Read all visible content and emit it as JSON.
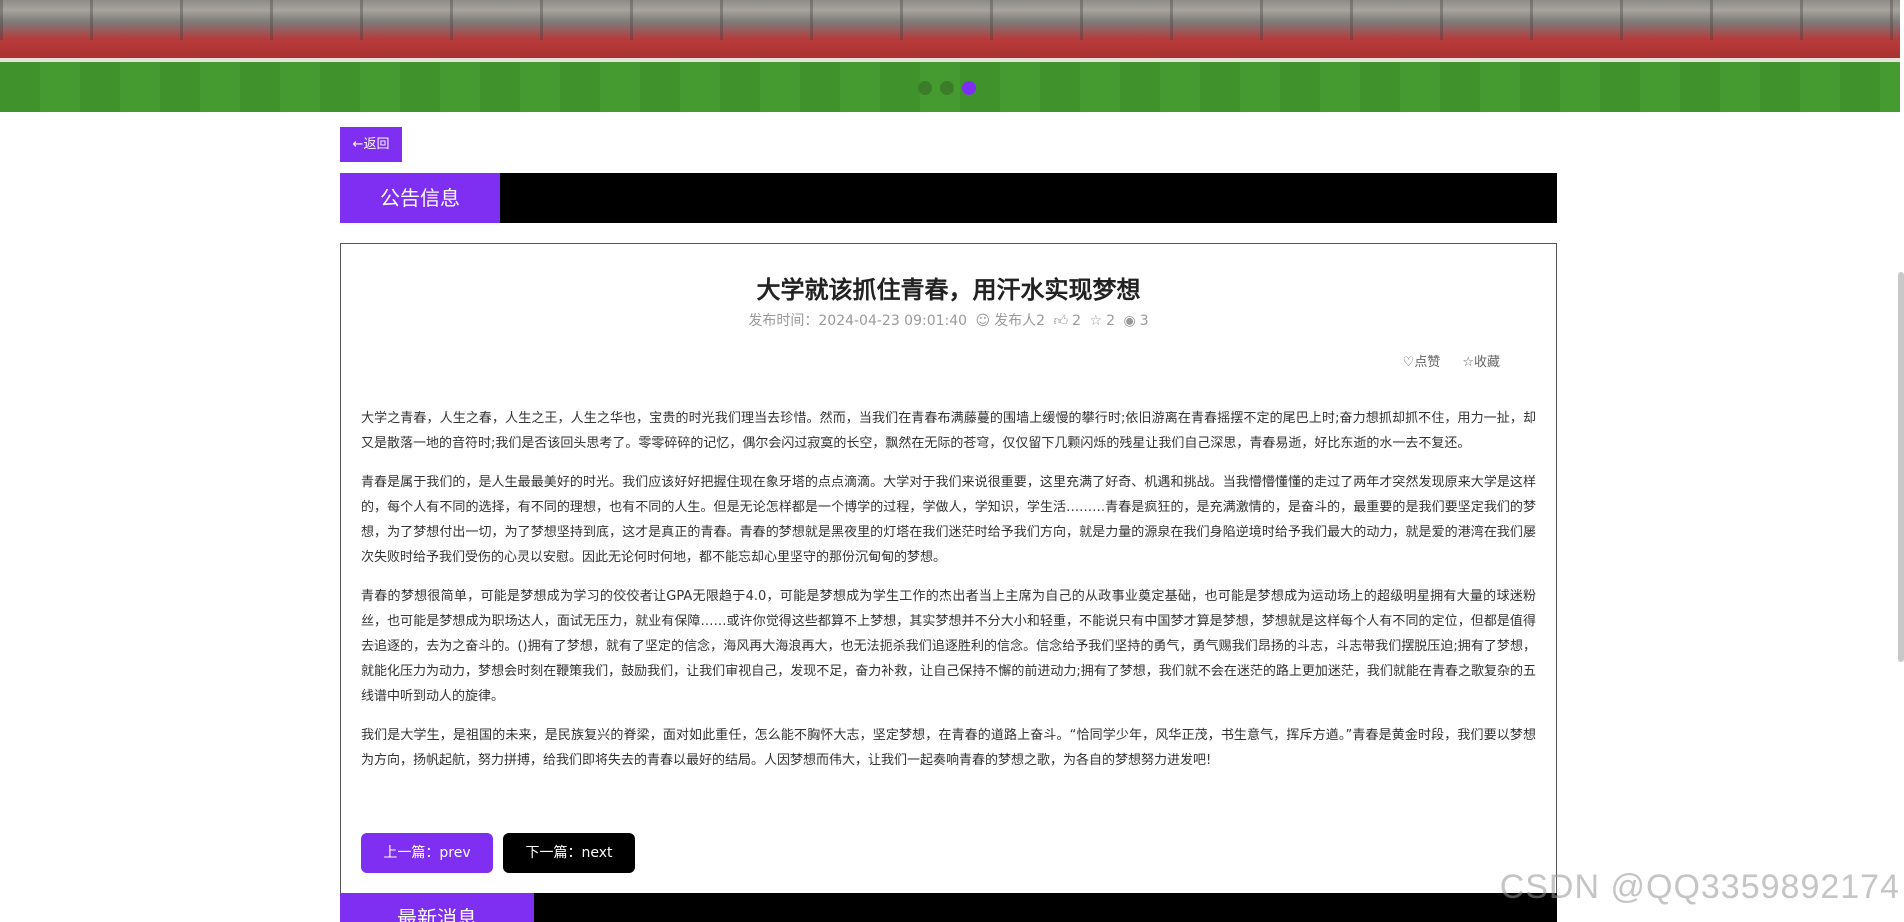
{
  "banner": {
    "slides": 3,
    "active_slide": 3
  },
  "back_label": "←返回",
  "notice_header": "公告信息",
  "article": {
    "title": "大学就该抓住青春，用汗水实现梦想",
    "publish_time": "发布时间：2024-04-23 09:01:40",
    "publisher": "发布人2",
    "likes": "2",
    "favorites": "2",
    "views": "3",
    "like_label": "点赞",
    "favorite_label": "收藏",
    "paragraphs": [
      "大学之青春，人生之春，人生之王，人生之华也，宝贵的时光我们理当去珍惜。然而，当我们在青春布满藤蔓的围墙上缓慢的攀行时;依旧游离在青春摇摆不定的尾巴上时;奋力想抓却抓不住，用力一扯，却又是散落一地的音符时;我们是否该回头思考了。零零碎碎的记忆，偶尔会闪过寂寞的长空，飘然在无际的苍穹，仅仅留下几颗闪烁的残星让我们自己深思，青春易逝，好比东逝的水一去不复还。",
      "青春是属于我们的，是人生最最美好的时光。我们应该好好把握住现在象牙塔的点点滴滴。大学对于我们来说很重要，这里充满了好奇、机遇和挑战。当我懵懵懂懂的走过了两年才突然发现原来大学是这样的，每个人有不同的选择，有不同的理想，也有不同的人生。但是无论怎样都是一个博学的过程，学做人，学知识，学生活………青春是疯狂的，是充满激情的，是奋斗的，最重要的是我们要坚定我们的梦想，为了梦想付出一切，为了梦想坚持到底，这才是真正的青春。青春的梦想就是黑夜里的灯塔在我们迷茫时给予我们方向，就是力量的源泉在我们身陷逆境时给予我们最大的动力，就是爱的港湾在我们屡次失败时给予我们受伤的心灵以安慰。因此无论何时何地，都不能忘却心里坚守的那份沉甸甸的梦想。",
      "青春的梦想很简单，可能是梦想成为学习的佼佼者让GPA无限趋于4.0，可能是梦想成为学生工作的杰出者当上主席为自己的从政事业奠定基础，也可能是梦想成为运动场上的超级明星拥有大量的球迷粉丝，也可能是梦想成为职场达人，面试无压力，就业有保障……或许你觉得这些都算不上梦想，其实梦想并不分大小和轻重，不能说只有中国梦才算是梦想，梦想就是这样每个人有不同的定位，但都是值得去追逐的，去为之奋斗的。()拥有了梦想，就有了坚定的信念，海风再大海浪再大，也无法扼杀我们追逐胜利的信念。信念给予我们坚持的勇气，勇气赐我们昂扬的斗志，斗志带我们摆脱压迫;拥有了梦想，就能化压力为动力，梦想会时刻在鞭策我们，鼓励我们，让我们审视自己，发现不足，奋力补救，让自己保持不懈的前进动力;拥有了梦想，我们就不会在迷茫的路上更加迷茫，我们就能在青春之歌复杂的五线谱中听到动人的旋律。",
      "我们是大学生，是祖国的未来，是民族复兴的脊梁，面对如此重任，怎么能不胸怀大志，坚定梦想，在青春的道路上奋斗。“恰同学少年，风华正茂，书生意气，挥斥方遒。”青春是黄金时段，我们要以梦想为方向，扬帆起航，努力拼搏，给我们即将失去的青春以最好的结局。人因梦想而伟大，让我们一起奏响青春的梦想之歌，为各自的梦想努力进发吧!"
    ]
  },
  "pager": {
    "prev_label": "上一篇：prev",
    "next_label": "下一篇：next"
  },
  "latest_header": "最新消息",
  "watermark": "CSDN @QQ3359892174",
  "colors": {
    "accent": "#7e2ff2",
    "header_bar": "#000000"
  }
}
